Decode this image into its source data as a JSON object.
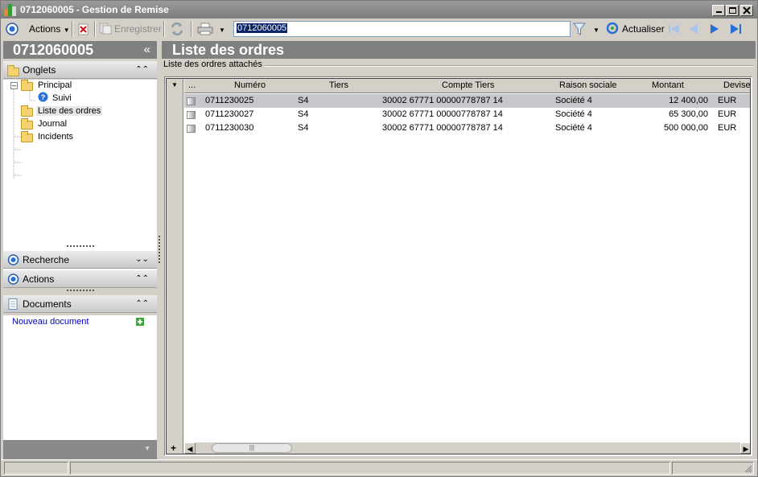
{
  "window": {
    "id": "0712060005",
    "separator": "-",
    "title": "Gestion de Remise"
  },
  "toolbar": {
    "actions_label": "Actions",
    "save_label": "Enregistrer",
    "address_value": "0712060005",
    "refresh_label": "Actualiser"
  },
  "left_panel": {
    "header": "0712060005",
    "collapse_glyph": "«",
    "onglets_label": "Onglets",
    "tree": {
      "principal": "Principal",
      "suivi": "Suivi",
      "liste_des_ordres": "Liste des ordres",
      "journal": "Journal",
      "incidents": "Incidents"
    },
    "recherche_label": "Recherche",
    "actions_label": "Actions",
    "documents_label": "Documents",
    "new_document_label": "Nouveau document"
  },
  "right_panel": {
    "header": "Liste des ordres",
    "group_title": "Liste des ordres attachés",
    "grid": {
      "columns": {
        "more": "...",
        "numero": "Numéro",
        "tiers": "Tiers",
        "compte_tiers": "Compte Tiers",
        "raison_sociale": "Raison sociale",
        "montant": "Montant",
        "devise": "Devise"
      },
      "rows": [
        {
          "numero": "0711230025",
          "tiers": "S4",
          "compte_tiers": "30002 67771 00000778787 14",
          "raison_sociale": "Société 4",
          "montant": "12 400,00",
          "devise": "EUR"
        },
        {
          "numero": "0711230027",
          "tiers": "S4",
          "compte_tiers": "30002 67771 00000778787 14",
          "raison_sociale": "Société 4",
          "montant": "65 300,00",
          "devise": "EUR"
        },
        {
          "numero": "0711230030",
          "tiers": "S4",
          "compte_tiers": "30002 67771 00000778787 14",
          "raison_sociale": "Société 4",
          "montant": "500 000,00",
          "devise": "EUR"
        }
      ],
      "add_glyph": "+"
    }
  },
  "colors": {
    "header_gray": "#808080",
    "selection": "#c8c7cc",
    "link_blue": "#0000c8",
    "nav_blue": "#2a6fd6"
  },
  "icons": [
    "app-icon",
    "actions-circle-icon",
    "delete-icon",
    "save-icon",
    "sync-icon",
    "print-icon",
    "filter-icon",
    "refresh-icon",
    "first-icon",
    "previous-icon",
    "next-icon",
    "last-icon",
    "folder-icon",
    "help-icon",
    "document-icon",
    "add-icon"
  ]
}
